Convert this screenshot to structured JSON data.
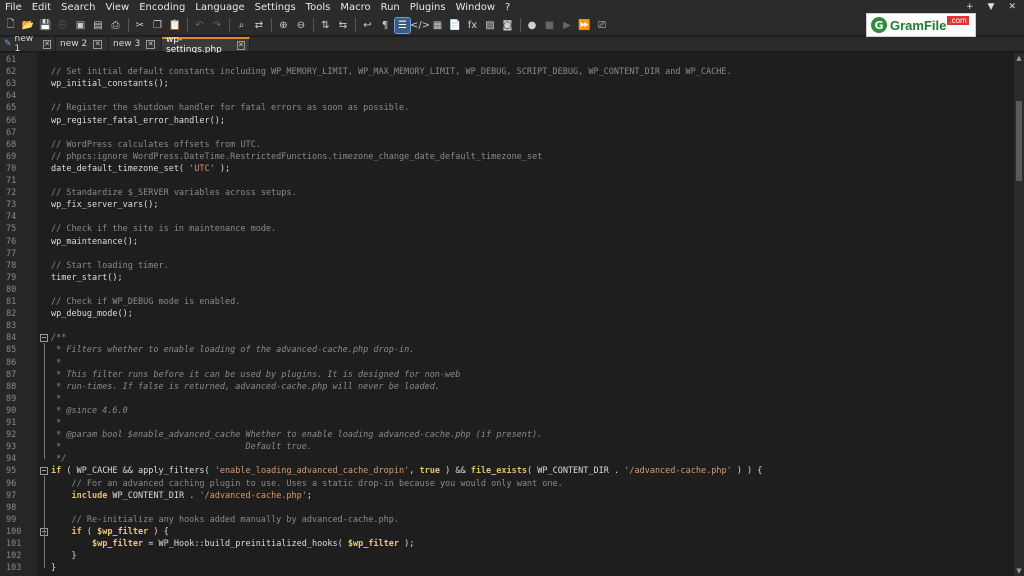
{
  "menu": [
    "File",
    "Edit",
    "Search",
    "View",
    "Encoding",
    "Language",
    "Settings",
    "Tools",
    "Macro",
    "Run",
    "Plugins",
    "Window",
    "?"
  ],
  "window_controls": [
    "+",
    "▼",
    "✕"
  ],
  "toolbar": [
    {
      "name": "new-file-icon",
      "glyph": "🗋"
    },
    {
      "name": "open-file-icon",
      "glyph": "📂"
    },
    {
      "name": "save-icon",
      "glyph": "💾",
      "dim": true
    },
    {
      "name": "save-all-icon",
      "glyph": "⎘",
      "dim": true
    },
    {
      "name": "close-icon",
      "glyph": "▣"
    },
    {
      "name": "close-all-icon",
      "glyph": "▤"
    },
    {
      "name": "print-icon",
      "glyph": "⎙"
    },
    {
      "sep": true
    },
    {
      "name": "cut-icon",
      "glyph": "✂"
    },
    {
      "name": "copy-icon",
      "glyph": "❐"
    },
    {
      "name": "paste-icon",
      "glyph": "📋"
    },
    {
      "sep": true
    },
    {
      "name": "undo-icon",
      "glyph": "↶",
      "dim": true
    },
    {
      "name": "redo-icon",
      "glyph": "↷",
      "dim": true
    },
    {
      "sep": true
    },
    {
      "name": "find-icon",
      "glyph": "⌕"
    },
    {
      "name": "replace-icon",
      "glyph": "⇄"
    },
    {
      "sep": true
    },
    {
      "name": "zoom-in-icon",
      "glyph": "⊕"
    },
    {
      "name": "zoom-out-icon",
      "glyph": "⊖"
    },
    {
      "sep": true
    },
    {
      "name": "sync-vertical-icon",
      "glyph": "⇅"
    },
    {
      "name": "sync-horizontal-icon",
      "glyph": "⇆"
    },
    {
      "sep": true
    },
    {
      "name": "word-wrap-icon",
      "glyph": "↩"
    },
    {
      "name": "show-all-chars-icon",
      "glyph": "¶"
    },
    {
      "name": "indent-guide-icon",
      "glyph": "☰",
      "active": true
    },
    {
      "name": "html-tag-icon",
      "glyph": "</>"
    },
    {
      "name": "map-icon",
      "glyph": "▦"
    },
    {
      "name": "document-list-icon",
      "glyph": "📄"
    },
    {
      "name": "function-list-icon",
      "glyph": "fx"
    },
    {
      "name": "folder-workspace-icon",
      "glyph": "▨"
    },
    {
      "name": "monitor-icon",
      "glyph": "◙"
    },
    {
      "sep": true
    },
    {
      "name": "record-macro-icon",
      "glyph": "●"
    },
    {
      "name": "stop-macro-icon",
      "glyph": "■",
      "dim": true
    },
    {
      "name": "play-macro-icon",
      "glyph": "▶",
      "dim": true
    },
    {
      "name": "play-multiple-icon",
      "glyph": "⏩"
    },
    {
      "name": "save-macro-icon",
      "glyph": "⎚"
    }
  ],
  "logo": {
    "g": "G",
    "text": "GramFile",
    "com": ".com"
  },
  "tabs": [
    {
      "label": "new 1",
      "pencil": true
    },
    {
      "label": "new 2"
    },
    {
      "label": "new 3"
    },
    {
      "label": "wp-settings.php",
      "active": true
    }
  ],
  "lines": [
    {
      "n": "61",
      "parts": []
    },
    {
      "n": "62",
      "parts": [
        [
          "cm",
          "// Set initial default constants including WP_MEMORY_LIMIT, WP_MAX_MEMORY_LIMIT, WP_DEBUG, SCRIPT_DEBUG, WP_CONTENT_DIR and WP_CACHE."
        ]
      ]
    },
    {
      "n": "63",
      "parts": [
        [
          "tx",
          "wp_initial_constants();"
        ]
      ]
    },
    {
      "n": "64",
      "parts": []
    },
    {
      "n": "65",
      "parts": [
        [
          "cm",
          "// Register the shutdown handler for fatal errors as soon as possible."
        ]
      ]
    },
    {
      "n": "66",
      "parts": [
        [
          "tx",
          "wp_register_fatal_error_handler();"
        ]
      ]
    },
    {
      "n": "67",
      "parts": []
    },
    {
      "n": "68",
      "parts": [
        [
          "cm",
          "// WordPress calculates offsets from UTC."
        ]
      ]
    },
    {
      "n": "69",
      "parts": [
        [
          "cm",
          "// phpcs:ignore WordPress.DateTime.RestrictedFunctions.timezone_change_date_default_timezone_set"
        ]
      ]
    },
    {
      "n": "70",
      "parts": [
        [
          "tx",
          "date_default_timezone_set( "
        ],
        [
          "str",
          "'UTC'"
        ],
        [
          "tx",
          " );"
        ]
      ]
    },
    {
      "n": "71",
      "parts": []
    },
    {
      "n": "72",
      "parts": [
        [
          "cm",
          "// Standardize $_SERVER variables across setups."
        ]
      ]
    },
    {
      "n": "73",
      "parts": [
        [
          "tx",
          "wp_fix_server_vars();"
        ]
      ]
    },
    {
      "n": "74",
      "parts": []
    },
    {
      "n": "75",
      "parts": [
        [
          "cm",
          "// Check if the site is in maintenance mode."
        ]
      ]
    },
    {
      "n": "76",
      "parts": [
        [
          "tx",
          "wp_maintenance();"
        ]
      ]
    },
    {
      "n": "77",
      "parts": []
    },
    {
      "n": "78",
      "parts": [
        [
          "cm",
          "// Start loading timer."
        ]
      ]
    },
    {
      "n": "79",
      "parts": [
        [
          "tx",
          "timer_start();"
        ]
      ]
    },
    {
      "n": "80",
      "parts": []
    },
    {
      "n": "81",
      "parts": [
        [
          "cm",
          "// Check if WP_DEBUG mode is enabled."
        ]
      ]
    },
    {
      "n": "82",
      "parts": [
        [
          "tx",
          "wp_debug_mode();"
        ]
      ]
    },
    {
      "n": "83",
      "parts": []
    },
    {
      "n": "84",
      "parts": [
        [
          "doc",
          "/**"
        ]
      ],
      "fold": "open"
    },
    {
      "n": "85",
      "parts": [
        [
          "doc",
          " * Filters whether to enable loading of the advanced-cache.php drop-in."
        ]
      ]
    },
    {
      "n": "86",
      "parts": [
        [
          "doc",
          " *"
        ]
      ]
    },
    {
      "n": "87",
      "parts": [
        [
          "doc",
          " * This filter runs before it can be used by plugins. It is designed for non-web"
        ]
      ]
    },
    {
      "n": "88",
      "parts": [
        [
          "doc",
          " * run-times. If false is returned, advanced-cache.php will never be loaded."
        ]
      ]
    },
    {
      "n": "89",
      "parts": [
        [
          "doc",
          " *"
        ]
      ]
    },
    {
      "n": "90",
      "parts": [
        [
          "doc",
          " * @since 4.6.0"
        ]
      ]
    },
    {
      "n": "91",
      "parts": [
        [
          "doc",
          " *"
        ]
      ]
    },
    {
      "n": "92",
      "parts": [
        [
          "doc",
          " * @param bool $enable_advanced_cache Whether to enable loading advanced-cache.php (if present)."
        ]
      ]
    },
    {
      "n": "93",
      "parts": [
        [
          "doc",
          " *                                    Default true."
        ]
      ]
    },
    {
      "n": "94",
      "parts": [
        [
          "doc",
          " */"
        ]
      ]
    },
    {
      "n": "95",
      "parts": [
        [
          "kw",
          "if"
        ],
        [
          "tx",
          " ( WP_CACHE && apply_filters( "
        ],
        [
          "str",
          "'enable_loading_advanced_cache_dropin'"
        ],
        [
          "tx",
          ", "
        ],
        [
          "kw",
          "true"
        ],
        [
          "tx",
          " ) && "
        ],
        [
          "kw",
          "file_exists"
        ],
        [
          "tx",
          "( WP_CONTENT_DIR . "
        ],
        [
          "str",
          "'/advanced-cache.php'"
        ],
        [
          "tx",
          " ) ) {"
        ]
      ],
      "fold": "open"
    },
    {
      "n": "96",
      "parts": [
        [
          "tx",
          "    "
        ],
        [
          "cm",
          "// For an advanced caching plugin to use. Uses a static drop-in because you would only want one."
        ]
      ]
    },
    {
      "n": "97",
      "parts": [
        [
          "tx",
          "    "
        ],
        [
          "kw",
          "include"
        ],
        [
          "tx",
          " WP_CONTENT_DIR . "
        ],
        [
          "str",
          "'/advanced-cache.php'"
        ],
        [
          "tx",
          ";"
        ]
      ]
    },
    {
      "n": "98",
      "parts": []
    },
    {
      "n": "99",
      "parts": [
        [
          "tx",
          "    "
        ],
        [
          "cm",
          "// Re-initialize any hooks added manually by advanced-cache.php."
        ]
      ]
    },
    {
      "n": "100",
      "parts": [
        [
          "tx",
          "    "
        ],
        [
          "kw",
          "if"
        ],
        [
          "tx",
          " ( "
        ],
        [
          "var",
          "$wp_filter"
        ],
        [
          "tx",
          " ) {"
        ]
      ],
      "fold": "open"
    },
    {
      "n": "101",
      "parts": [
        [
          "tx",
          "        "
        ],
        [
          "var",
          "$wp_filter"
        ],
        [
          "tx",
          " = WP_Hook::build_preinitialized_hooks( "
        ],
        [
          "var",
          "$wp_filter"
        ],
        [
          "tx",
          " );"
        ]
      ]
    },
    {
      "n": "102",
      "parts": [
        [
          "tx",
          "    }"
        ]
      ]
    },
    {
      "n": "103",
      "parts": [
        [
          "tx",
          "}"
        ]
      ]
    }
  ]
}
